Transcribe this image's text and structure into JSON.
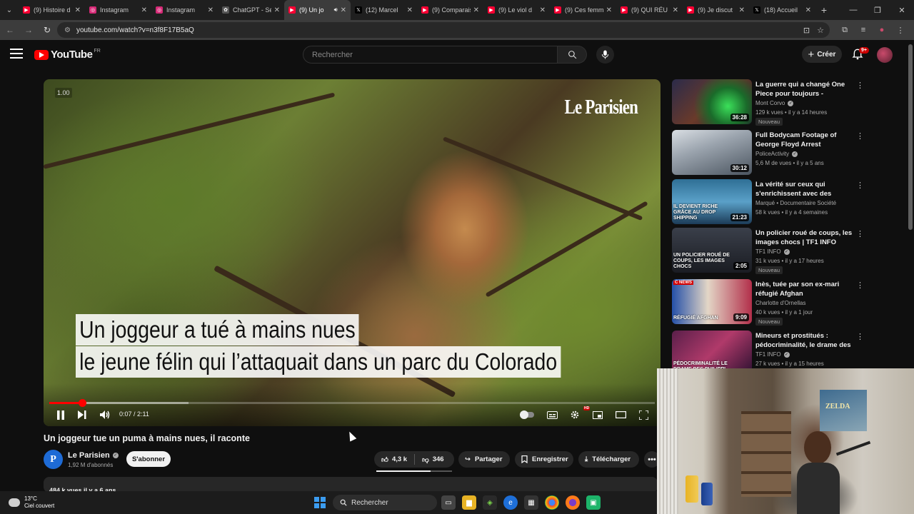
{
  "browser": {
    "tabs": [
      {
        "label": "(9) Histoire d",
        "icon": "youtube-icon",
        "color": "#ff0033",
        "active": false
      },
      {
        "label": "Instagram",
        "icon": "instagram-icon",
        "color": "#d62976",
        "active": false
      },
      {
        "label": "Instagram",
        "icon": "instagram-icon",
        "color": "#d62976",
        "active": false
      },
      {
        "label": "ChatGPT - Sé",
        "icon": "chatgpt-icon",
        "color": "#555555",
        "active": false
      },
      {
        "label": "(9) Un jo",
        "icon": "youtube-icon",
        "color": "#ff0033",
        "active": true
      },
      {
        "label": "(12) Marcel",
        "icon": "x-icon",
        "color": "#000000",
        "active": false
      },
      {
        "label": "(9) Comparais",
        "icon": "youtube-icon",
        "color": "#ff0033",
        "active": false
      },
      {
        "label": "(9) Le viol d",
        "icon": "youtube-icon",
        "color": "#ff0033",
        "active": false
      },
      {
        "label": "(9) Ces femm",
        "icon": "youtube-icon",
        "color": "#ff0033",
        "active": false
      },
      {
        "label": "(9) QUI RÉU",
        "icon": "youtube-icon",
        "color": "#ff0033",
        "active": false
      },
      {
        "label": "(9) Je discut",
        "icon": "youtube-icon",
        "color": "#ff0033",
        "active": false
      },
      {
        "label": "(18) Accueil",
        "icon": "x-icon",
        "color": "#000000",
        "active": false
      }
    ],
    "url": "youtube.com/watch?v=n3f8F17B5aQ"
  },
  "header": {
    "logo_text": "YouTube",
    "country": "FR",
    "search_placeholder": "Rechercher",
    "create_label": "Créer",
    "notif_count": "9+"
  },
  "player": {
    "speed": "1.00",
    "brand": "Le Parisien",
    "caption_line1": "Un joggeur a tué à mains nues",
    "caption_line2": "le jeune félin qui l’attaquait dans un parc du Colorado",
    "time": "0:07 / 2:11",
    "progress": 0.054,
    "buffered": 0.23
  },
  "video": {
    "title": "Un joggeur tue un puma à mains nues, il raconte",
    "channel": "Le Parisien",
    "channel_initial": "P",
    "subscribers": "1,92 M d'abonnés",
    "subscribe_label": "S'abonner",
    "likes": "4,3 k",
    "dislikes": "346",
    "share_label": "Partager",
    "save_label": "Enregistrer",
    "download_label": "Télécharger",
    "description_peek": "484 k vues  il y a 6 ans"
  },
  "recommendations": [
    {
      "title": "La guerre qui a changé One Piece pour toujours - Chapitre...",
      "channel": "Mont Corvo",
      "meta": "129 k vues • il y a 14 heures",
      "duration": "36:28",
      "badge": "Nouveau",
      "verified": true,
      "thumb_label": ""
    },
    {
      "title": "Full Bodycam Footage of George Floyd Arrest",
      "channel": "PoliceActivity",
      "meta": "5,6 M de vues • il y a 5 ans",
      "duration": "30:12",
      "badge": "",
      "verified": true,
      "thumb_label": ""
    },
    {
      "title": "La vérité sur ceux qui s'enrichissent avec des produi...",
      "channel": "Marqué • Documentaire Société",
      "meta": "58 k vues • il y a 4 semaines",
      "duration": "21:23",
      "badge": "",
      "verified": false,
      "thumb_label": "IL DEVIENT RICHE GRÂCE AU DROP SHIPPING"
    },
    {
      "title": "Un policier roué de coups, les images chocs | TF1 INFO",
      "channel": "TF1 INFO",
      "meta": "31 k vues • il y a 17 heures",
      "duration": "2:05",
      "badge": "Nouveau",
      "verified": true,
      "thumb_label": "UN POLICIER ROUÉ DE COUPS, LES IMAGES CHOCS"
    },
    {
      "title": "Inès, tuée par son ex-mari réfugié Afghan",
      "channel": "Charlotte d'Ornellas",
      "meta": "40 k vues • il y a 1 jour",
      "duration": "9:09",
      "badge": "Nouveau",
      "verified": false,
      "thumb_label": "RÉFUGIÉ AFGHAN",
      "corner": "C NEWS"
    },
    {
      "title": "Mineurs et prostitués : pédocriminalité, le drame des ...",
      "channel": "TF1 INFO",
      "meta": "27 k vues • il y a 15 heures",
      "duration": "",
      "badge": "",
      "verified": true,
      "thumb_label": "PÉDOCRIMINALITÉ LE DRAME DES PHILIPPI"
    }
  ],
  "webcam": {
    "poster_text": "ZELDA"
  },
  "taskbar": {
    "temp": "13°C",
    "weather": "Ciel couvert",
    "search_label": "Rechercher"
  },
  "colors": {
    "accent": "#ff0000",
    "bg": "#0f0f0f",
    "surface": "#272727"
  }
}
